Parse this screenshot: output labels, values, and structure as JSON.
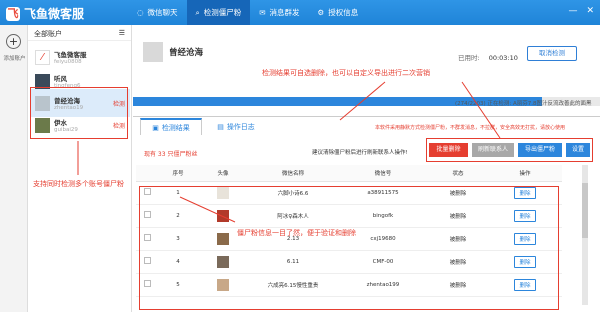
{
  "app": {
    "title": "飞鱼微客服",
    "logo_glyph": "飞"
  },
  "nav": {
    "tabs": [
      {
        "label": "微信聊天",
        "icon": "chat-icon",
        "active": false
      },
      {
        "label": "检测僵尸粉",
        "icon": "search-icon",
        "active": true
      },
      {
        "label": "消息群发",
        "icon": "mail-icon",
        "active": false
      },
      {
        "label": "授权信息",
        "icon": "settings-icon",
        "active": false
      }
    ]
  },
  "sidebar": {
    "add_label": "添加账户",
    "add_glyph": "+"
  },
  "accounts": {
    "header": "全部账户",
    "list_icon": "☰",
    "items": [
      {
        "name": "飞鱼微客服",
        "sub": "feiyu0808",
        "status": ""
      },
      {
        "name": "听风",
        "sub": "tingfeng6",
        "status": ""
      },
      {
        "name": "曾经沧海",
        "sub": "zhentao19",
        "status": "检测"
      },
      {
        "name": "伊水",
        "sub": "guibai29",
        "status": "检测"
      }
    ]
  },
  "profile": {
    "name": "曾经沧海",
    "elapsed_label": "已用时:",
    "elapsed_value": "00:03:10",
    "cancel_label": "取消检测"
  },
  "progress": {
    "fraction": 0.875,
    "text": "(274/2203) 正在检测: A丽芬7.8图汁反流改善此的面黑"
  },
  "panel": {
    "tab_results": "检测结果",
    "tab_log": "操作日志",
    "note": "本软件采用静默方式检测僵尸粉，不群发消息，不拉群，安全高效无打扰，请放心使用",
    "found_text": "现有 33 只僵尸粉丝",
    "hint": "建议清除僵尸粉后进行刷新联系人操作!",
    "buttons": [
      {
        "label": "批量删除",
        "color": "#e53e30"
      },
      {
        "label": "刷新联系人",
        "color": "#a8a8a8"
      },
      {
        "label": "导出僵尸粉",
        "color": "#2c86dc"
      },
      {
        "label": "设置",
        "color": "#2c86dc"
      }
    ]
  },
  "table": {
    "headers": [
      "序号",
      "头像",
      "微信名称",
      "微信号",
      "状态",
      "操作"
    ],
    "rows": [
      {
        "no": "1",
        "name": "六脚小诗6.6",
        "wxid": "a38911575",
        "status": "被删除",
        "action": "删除"
      },
      {
        "no": "2",
        "name": "阿冰♀森木人",
        "wxid": "bingofk",
        "status": "被删除",
        "action": "删除"
      },
      {
        "no": "3",
        "name": "2.13",
        "wxid": "cxj19680",
        "status": "被删除",
        "action": "删除"
      },
      {
        "no": "4",
        "name": "6.11",
        "wxid": "CMF-00",
        "status": "被删除",
        "action": "删除"
      },
      {
        "no": "5",
        "name": "六成亮6.15慢性重贵",
        "wxid": "zhentao199",
        "status": "被删除",
        "action": "删除"
      }
    ]
  },
  "annotations": {
    "top": "检测结果可自选删除，也可以自定义导出进行二次营销",
    "left": "支持同时检测多个账号僵尸粉",
    "table": "僵尸粉信息一目了然，便于验证和删除"
  },
  "colors": {
    "brand": "#2f95e6",
    "highlight": "#e53e30"
  }
}
